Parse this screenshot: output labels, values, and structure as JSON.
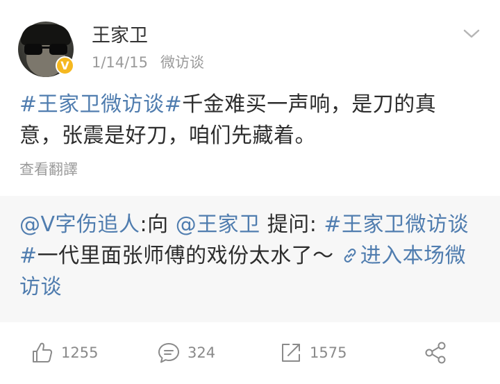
{
  "post": {
    "author": "王家卫",
    "date": "1/14/15",
    "source": "微访谈",
    "content": {
      "hashtag": "#王家卫微访谈#",
      "text": "千金难买一声响，是刀的真意，张震是好刀，咱们先藏着。"
    },
    "translate_label": "查看翻譯"
  },
  "repost": {
    "asker": "@V字伤追人",
    "to_word": ":向 ",
    "mention": "@王家卫",
    "ask_word": " 提问: ",
    "hashtag": "#王家卫微访谈#",
    "text": "一代里面张师傅的戏份太水了～ ",
    "link_label": "进入本场微访谈"
  },
  "actions": {
    "likes": "1255",
    "comments": "324",
    "reposts": "1575"
  },
  "icons": {
    "badge": "verified-v-badge",
    "menu": "chevron-down-icon",
    "like": "thumbs-up-icon",
    "comment": "comment-bubble-icon",
    "repost": "share-out-icon",
    "share": "share-nodes-icon",
    "link": "link-icon"
  },
  "colors": {
    "link_blue": "#507daf",
    "badge_yellow": "#f5b820",
    "repost_background": "#f7f7f7",
    "meta_gray": "#9a9a9a"
  }
}
